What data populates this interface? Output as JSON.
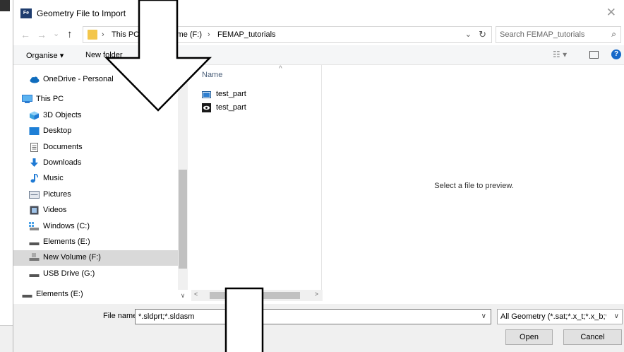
{
  "window": {
    "app_icon_text": "Fe",
    "title": "Geometry File to Import",
    "close_glyph": "✕"
  },
  "nav": {
    "back_icon": "←",
    "forward_icon": "→",
    "recent_icon": "⌄",
    "up_icon": "↑",
    "breadcrumb": [
      "This PC",
      "lume (F:)",
      "FEMAP_tutorials"
    ],
    "breadcrumb_sep": "›",
    "dropdown_icon": "⌄",
    "refresh_icon": "↻",
    "search_placeholder": "Search FEMAP_tutorials",
    "search_icon": "⌕"
  },
  "toolbar": {
    "organise_label": "Organise ▾",
    "new_folder_label": "New folder",
    "view_icon": "☷ ▾",
    "help_icon": "?"
  },
  "sidebar": {
    "items": [
      {
        "label": "OneDrive - Personal",
        "icon": "cloud-icon",
        "color": "#0f6cbd"
      },
      {
        "label": "This PC",
        "icon": "computer-icon",
        "color": "#2b7bd0"
      },
      {
        "label": "3D Objects",
        "icon": "cube-icon",
        "color": "#3ba3e0"
      },
      {
        "label": "Desktop",
        "icon": "desktop-icon",
        "color": "#1e7fd6"
      },
      {
        "label": "Documents",
        "icon": "document-icon",
        "color": "#6d6d6d"
      },
      {
        "label": "Downloads",
        "icon": "download-icon",
        "color": "#1f7ad4"
      },
      {
        "label": "Music",
        "icon": "music-icon",
        "color": "#1f7ad4"
      },
      {
        "label": "Pictures",
        "icon": "picture-icon",
        "color": "#6b7a8f"
      },
      {
        "label": "Videos",
        "icon": "video-icon",
        "color": "#4a4f5a"
      },
      {
        "label": "Windows  (C:)",
        "icon": "drive-icon",
        "color": "#4da3e8"
      },
      {
        "label": "Elements (E:)",
        "icon": "drive-icon",
        "color": "#555555"
      },
      {
        "label": "New Volume (F:)",
        "icon": "drive-icon",
        "color": "#777777"
      },
      {
        "label": "USB Drive (G:)",
        "icon": "drive-icon",
        "color": "#555555"
      }
    ],
    "bottom_item": {
      "label": "Elements (E:)",
      "icon": "drive-icon"
    }
  },
  "files": {
    "column_name": "Name",
    "sort_glyph": "^",
    "rows": [
      {
        "label": "test_part",
        "icon": "folder-file-icon"
      },
      {
        "label": "test_part",
        "icon": "eye-file-icon"
      }
    ]
  },
  "preview": {
    "message": "Select a file to preview."
  },
  "footer": {
    "file_name_label": "File name:",
    "file_name_value": "*.sldprt;*.sldasm",
    "file_type_value": "All Geometry (*.sat;*.x_t;*.x_b;*.",
    "open_label": "Open",
    "cancel_label": "Cancel"
  }
}
